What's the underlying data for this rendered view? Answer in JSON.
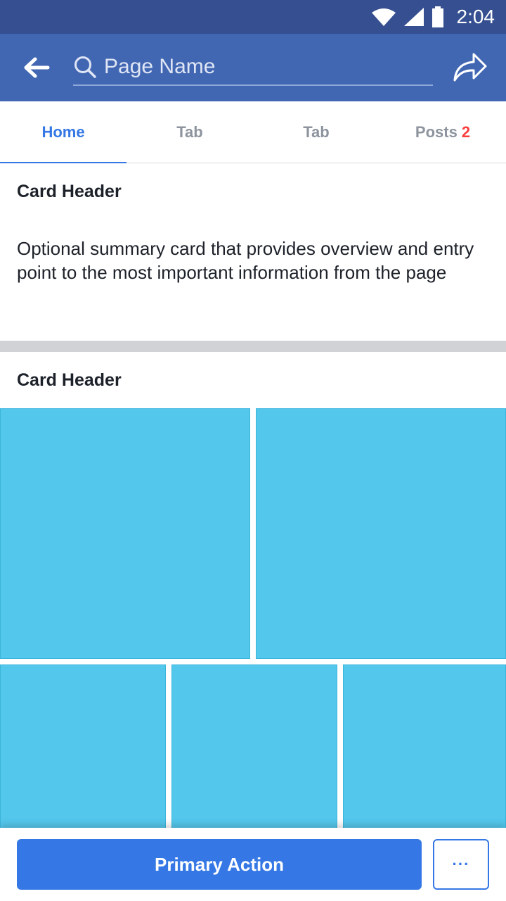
{
  "status_bar": {
    "time": "2:04"
  },
  "app_bar": {
    "search_placeholder": "Page Name"
  },
  "tabs": [
    {
      "label": "Home"
    },
    {
      "label": "Tab"
    },
    {
      "label": "Tab"
    },
    {
      "label": "Posts",
      "badge": "2"
    }
  ],
  "card_summary": {
    "header": "Card Header",
    "body": "Optional summary card that provides overview and entry point to the most important information from the page"
  },
  "card_media": {
    "header": "Card Header"
  },
  "bottom_bar": {
    "primary_label": "Primary Action",
    "more_label": "···"
  },
  "colors": {
    "status_bar": "#354f90",
    "app_bar": "#4267b2",
    "accent": "#3578e5",
    "badge": "#fa3e3e",
    "tile": "#54c7ec"
  },
  "icons": [
    "wifi-icon",
    "cell-signal-icon",
    "battery-icon",
    "back-arrow-icon",
    "search-icon",
    "share-icon"
  ]
}
